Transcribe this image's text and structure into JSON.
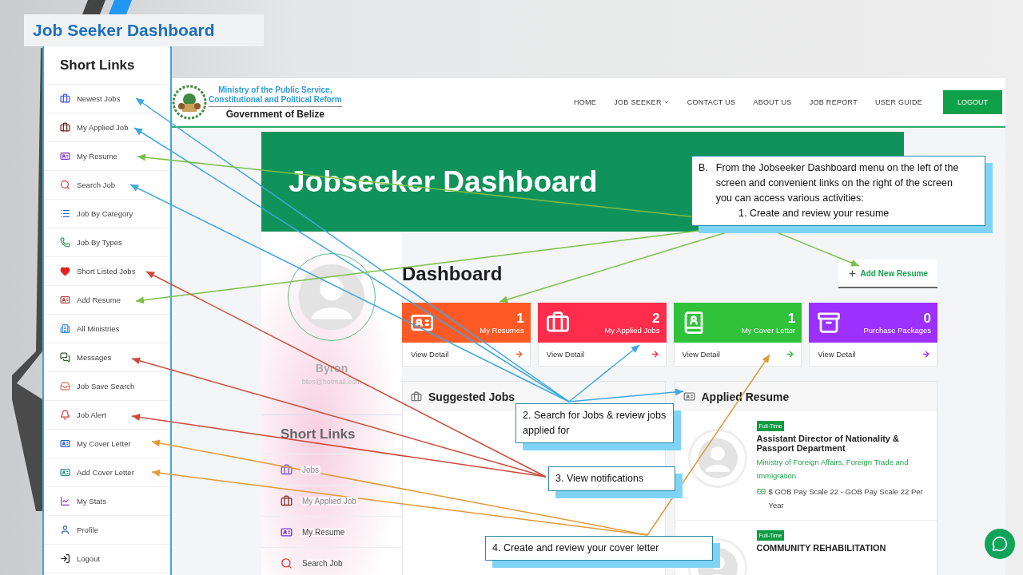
{
  "slide": {
    "title": "Job Seeker Dashboard"
  },
  "short_links": {
    "title": "Short Links",
    "items": [
      {
        "label": "Newest Jobs"
      },
      {
        "label": "My Applied Job"
      },
      {
        "label": "My Resume"
      },
      {
        "label": "Search Job"
      },
      {
        "label": "Job By Category"
      },
      {
        "label": "Job By Types"
      },
      {
        "label": "Short Listed Jobs"
      },
      {
        "label": "Add Resume"
      },
      {
        "label": "All Ministries"
      },
      {
        "label": "Messages"
      },
      {
        "label": "Job Save Search"
      },
      {
        "label": "Job Alert"
      },
      {
        "label": "My Cover Letter"
      },
      {
        "label": "Add Cover Letter"
      },
      {
        "label": "My Stats"
      },
      {
        "label": "Profile"
      },
      {
        "label": "Logout"
      }
    ]
  },
  "site": {
    "header": {
      "ministry_lines": [
        "Ministry of the Public Service,",
        "Constitutional and Political Reform"
      ],
      "government": "Government of Belize",
      "nav": [
        {
          "label": "HOME",
          "dropdown": false
        },
        {
          "label": "JOB SEEKER",
          "dropdown": true
        },
        {
          "label": "CONTACT US",
          "dropdown": false
        },
        {
          "label": "ABOUT US",
          "dropdown": false
        },
        {
          "label": "JOB REPORT",
          "dropdown": false
        },
        {
          "label": "USER GUIDE",
          "dropdown": false
        }
      ],
      "logout": "LOGOUT"
    },
    "banner": "Jobseeker Dashboard",
    "profile": {
      "name": "Byron",
      "email": "btes@hotmail.com",
      "links_title": "Short Links",
      "links": [
        {
          "label": "Jobs",
          "faded": true
        },
        {
          "label": "My Applied Job",
          "faded": true
        },
        {
          "label": "My Resume",
          "faded": false
        },
        {
          "label": "Search Job",
          "faded": false
        }
      ]
    },
    "heading": "Dashboard",
    "add_button": "Add New Resume",
    "stats": [
      {
        "count": "1",
        "label": "My Resumes",
        "link": "View Detail",
        "color": "#ff5a26"
      },
      {
        "count": "2",
        "label": "My Applied Jobs",
        "link": "View Detail",
        "color": "#ff2d4b"
      },
      {
        "count": "1",
        "label": "My Cover Letter",
        "link": "View Detail",
        "color": "#2fc23a"
      },
      {
        "count": "0",
        "label": "Purchase Packages",
        "link": "View Detail",
        "color": "#9b30ff"
      }
    ],
    "suggested": {
      "title": "Suggested Jobs"
    },
    "applied": {
      "title": "Applied Resume",
      "jobs": [
        {
          "type": "Full-Time",
          "title": "Assistant Director of Nationality & Passport Department",
          "ministry": "Ministry of Foreign Affairs, Foreign Trade and Immigration",
          "pay": "$ GOB Pay Scale 22 - GOB Pay Scale 22 Per Year"
        },
        {
          "type": "Full-Time",
          "title": "COMMUNITY REHABILITATION"
        }
      ]
    }
  },
  "callouts": [
    {
      "marker": "B.",
      "text": "From the Jobseeker Dashboard menu on the left of the screen and convenient links on the right of the screen you can access various activities:",
      "item": "1. Create and review your resume"
    },
    {
      "text": "2. Search for Jobs & review jobs applied for"
    },
    {
      "text": "3.  View notifications"
    },
    {
      "text": "4.  Create and review your cover letter"
    }
  ]
}
